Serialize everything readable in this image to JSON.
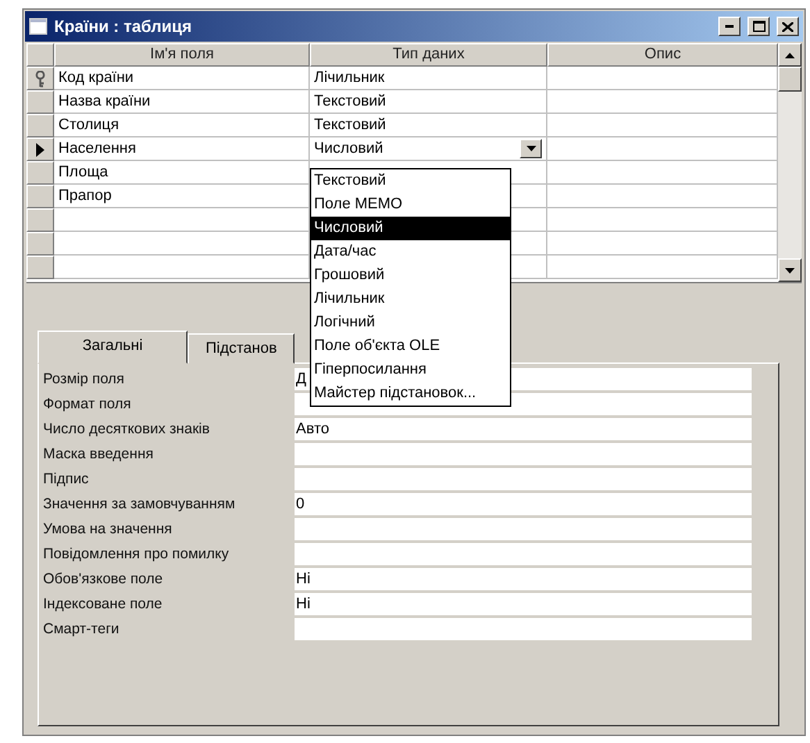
{
  "window": {
    "title": "Країни : таблиця"
  },
  "grid": {
    "columns": [
      "Ім'я поля",
      "Тип даних",
      "Опис"
    ],
    "fields": [
      {
        "name": "Код країни",
        "type": "Лічильник",
        "key": true,
        "current": false
      },
      {
        "name": "Назва країни",
        "type": "Текстовий",
        "key": false,
        "current": false
      },
      {
        "name": "Столиця",
        "type": "Текстовий",
        "key": false,
        "current": false
      },
      {
        "name": "Населення",
        "type": "Числовий",
        "key": false,
        "current": true,
        "dropdown": [
          {
            "label": "Текстовий",
            "selected": false
          },
          {
            "label": "Поле MEMO",
            "selected": false
          },
          {
            "label": "Числовий",
            "selected": true
          },
          {
            "label": "Дата/час",
            "selected": false
          },
          {
            "label": "Грошовий",
            "selected": false
          },
          {
            "label": "Лічильник",
            "selected": false
          },
          {
            "label": "Логічний",
            "selected": false
          },
          {
            "label": "Поле об'єкта OLE",
            "selected": false
          },
          {
            "label": "Гіперпосилання",
            "selected": false
          },
          {
            "label": "Майстер підстановок...",
            "selected": false
          }
        ]
      },
      {
        "name": "Площа",
        "key": false,
        "current": false
      },
      {
        "name": "Прапор",
        "key": false,
        "current": false
      }
    ]
  },
  "tabs": [
    {
      "label": "Загальні",
      "selected": true
    },
    {
      "label": "Підстанов",
      "selected": false
    }
  ],
  "properties": [
    {
      "label": "Розмір поля",
      "value": "Д"
    },
    {
      "label": "Формат поля"
    },
    {
      "label": "Число десяткових знаків",
      "value": "Авто"
    },
    {
      "label": "Маска введення"
    },
    {
      "label": "Підпис"
    },
    {
      "label": "Значення за замовчуванням",
      "value": "0"
    },
    {
      "label": "Умова на значення"
    },
    {
      "label": "Повідомлення про помилку"
    },
    {
      "label": "Обов'язкове поле",
      "value": "Ні"
    },
    {
      "label": "Індексоване поле",
      "value": "Ні"
    },
    {
      "label": "Смарт-теги"
    }
  ]
}
